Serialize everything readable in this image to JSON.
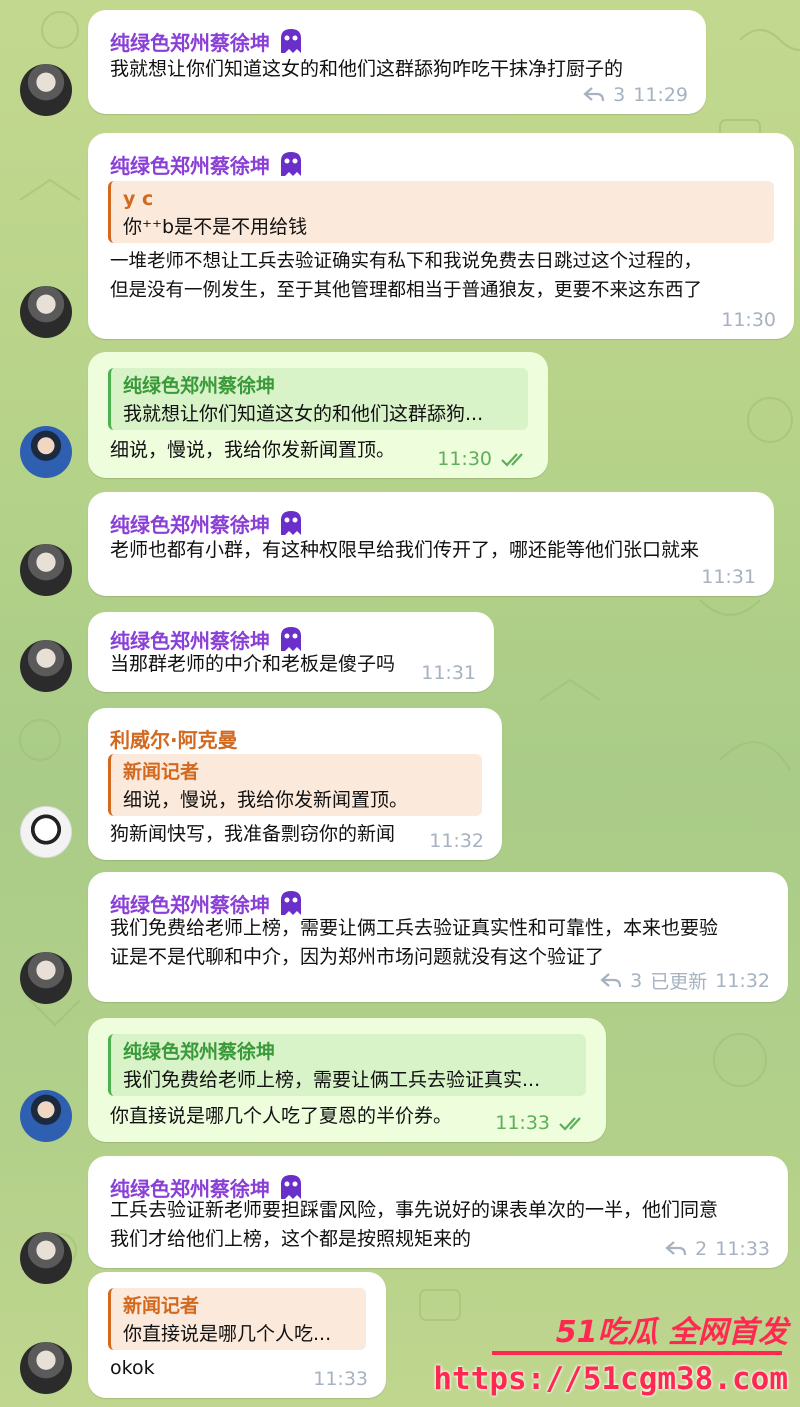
{
  "messages": [
    {
      "sender": "纯绿色郑州蔡徐坤",
      "text": "我就想让你们知道这女的和他们这群舔狗咋吃干抹净打厨子的",
      "replies": "3",
      "time": "11:29"
    },
    {
      "sender": "纯绿色郑州蔡徐坤",
      "quote": {
        "name": "y c",
        "text": "你⁺⁺b是不是不用给钱"
      },
      "text_lines": [
        "一堆老师不想让工兵去验证确实有私下和我说免费去日跳过这个过程的，",
        "但是没有一例发生，至于其他管理都相当于普通狼友，更要不来这东西了"
      ],
      "time": "11:30"
    },
    {
      "quote": {
        "name": "纯绿色郑州蔡徐坤",
        "text": "我就想让你们知道这女的和他们这群舔狗..."
      },
      "text": "细说，慢说，我给你发新闻置顶。",
      "time": "11:30"
    },
    {
      "sender": "纯绿色郑州蔡徐坤",
      "text": "老师也都有小群，有这种权限早给我们传开了，哪还能等他们张口就来",
      "time": "11:31"
    },
    {
      "sender": "纯绿色郑州蔡徐坤",
      "text": "当那群老师的中介和老板是傻子吗",
      "time": "11:31"
    },
    {
      "sender": "利威尔·阿克曼",
      "quote": {
        "name": "新闻记者",
        "text": "细说，慢说，我给你发新闻置顶。"
      },
      "text": "狗新闻快写，我准备剽窃你的新闻",
      "time": "11:32"
    },
    {
      "sender": "纯绿色郑州蔡徐坤",
      "text_lines": [
        "我们免费给老师上榜，需要让俩工兵去验证真实性和可靠性，本来也要验",
        "证是不是代聊和中介，因为郑州市场问题就没有这个验证了"
      ],
      "replies": "3",
      "edited": "已更新",
      "time": "11:32"
    },
    {
      "quote": {
        "name": "纯绿色郑州蔡徐坤",
        "text": "我们免费给老师上榜，需要让俩工兵去验证真实..."
      },
      "text": "你直接说是哪几个人吃了夏恩的半价券。",
      "time": "11:33"
    },
    {
      "sender": "纯绿色郑州蔡徐坤",
      "text_lines": [
        "工兵去验证新老师要担踩雷风险，事先说好的课表单次的一半，他们同意",
        "我们才给他们上榜，这个都是按照规矩来的"
      ],
      "replies": "2",
      "time": "11:33"
    },
    {
      "quote": {
        "name": "新闻记者",
        "text": "你直接说是哪几个人吃..."
      },
      "text": "okok",
      "time": "11:33"
    }
  ],
  "watermark": {
    "brand": "51吃瓜 全网首发",
    "url": "https://51cgm38.com"
  },
  "colors": {
    "sender_purple": "#8a3fd6",
    "sender_orange": "#d2691e",
    "quote_green": "#4caf50",
    "time_green": "#5fae5a",
    "watermark_red": "#ff2850"
  }
}
